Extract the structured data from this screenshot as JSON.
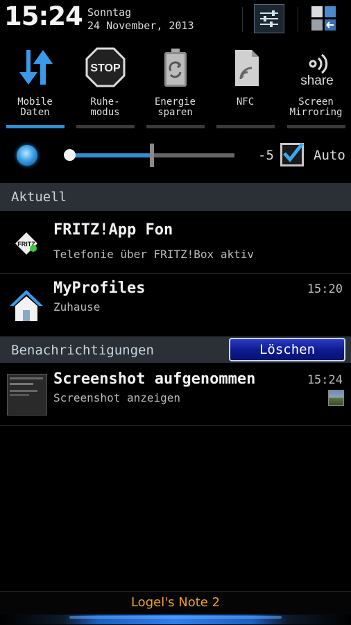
{
  "status": {
    "time": "15:24",
    "weekday": "Sonntag",
    "date": "24 November, 2013"
  },
  "quick_toggles": [
    {
      "label": "Mobile\nDaten",
      "icon": "mobile-data-icon",
      "active": true
    },
    {
      "label": "Ruhe-\nmodus",
      "icon": "stop-sign-icon",
      "active": false
    },
    {
      "label": "Energie\nsparen",
      "icon": "battery-recycle-icon",
      "active": false
    },
    {
      "label": "NFC",
      "icon": "nfc-icon",
      "active": false
    },
    {
      "label": "Screen\nMirroring",
      "icon": "share-icon",
      "icon_text": "share",
      "active": false
    }
  ],
  "brightness": {
    "level": "-5",
    "fraction": 0.5,
    "auto_label": "Auto",
    "auto_checked": true
  },
  "sections": {
    "ongoing": "Aktuell",
    "notifications": "Benachrichtigungen",
    "clear_label": "Löschen"
  },
  "ongoing": [
    {
      "title": "FRITZ!App Fon",
      "subtitle": "Telefonie über FRITZ!Box aktiv",
      "time": "",
      "icon": "fritz-app-icon"
    },
    {
      "title": "MyProfiles",
      "subtitle": "Zuhause",
      "time": "15:20",
      "icon": "home-icon"
    }
  ],
  "notifications": [
    {
      "title": "Screenshot aufgenommen",
      "subtitle": "Screenshot anzeigen",
      "time": "15:24",
      "icon": "screenshot-thumbnail"
    }
  ],
  "carrier": "Logel's Note 2",
  "colors": {
    "accent": "#2e8fce",
    "section_bg": "#2b3036",
    "carrier_text": "#f0a020",
    "clear_button": "#1428a8"
  }
}
